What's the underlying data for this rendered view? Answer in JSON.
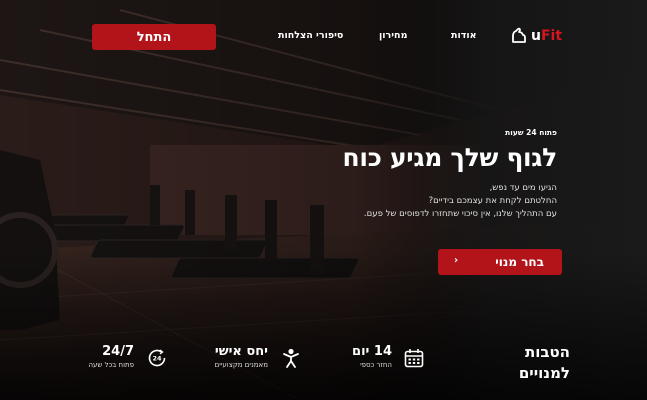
{
  "brand": {
    "u": "u",
    "fit": "Fit"
  },
  "nav": {
    "about": "אודות",
    "pricing": "מחירון",
    "success": "סיפורי הצלחות",
    "start_button": "התחל"
  },
  "hero": {
    "eyebrow": "פתוח 24 שעות",
    "headline": "לגוף שלך מגיע כוח",
    "desc_lines": [
      "הגיעו מים עד נפש,",
      "החלטתם לקחת את עצמכם בידיים?",
      "עם התהליך שלנו, אין סיכוי שתחזרו לדפוסים של פעם."
    ],
    "cta_label": "בחר מנוי",
    "cta_arrow": "‹"
  },
  "benefits": {
    "title_line1": "הטבות",
    "title_line2": "למנויים",
    "items": [
      {
        "title": "14 יום",
        "subtitle": "החזר כספי",
        "icon": "calendar-icon"
      },
      {
        "title": "יחס אישי",
        "subtitle": "מאמנים מקצועיים",
        "icon": "trainer-icon"
      },
      {
        "title": "24/7",
        "subtitle": "פתוח בכל שעה",
        "icon": "clock-24-icon",
        "icon_text": "24"
      }
    ]
  },
  "colors": {
    "accent": "#b3141a",
    "background": "#121212"
  }
}
